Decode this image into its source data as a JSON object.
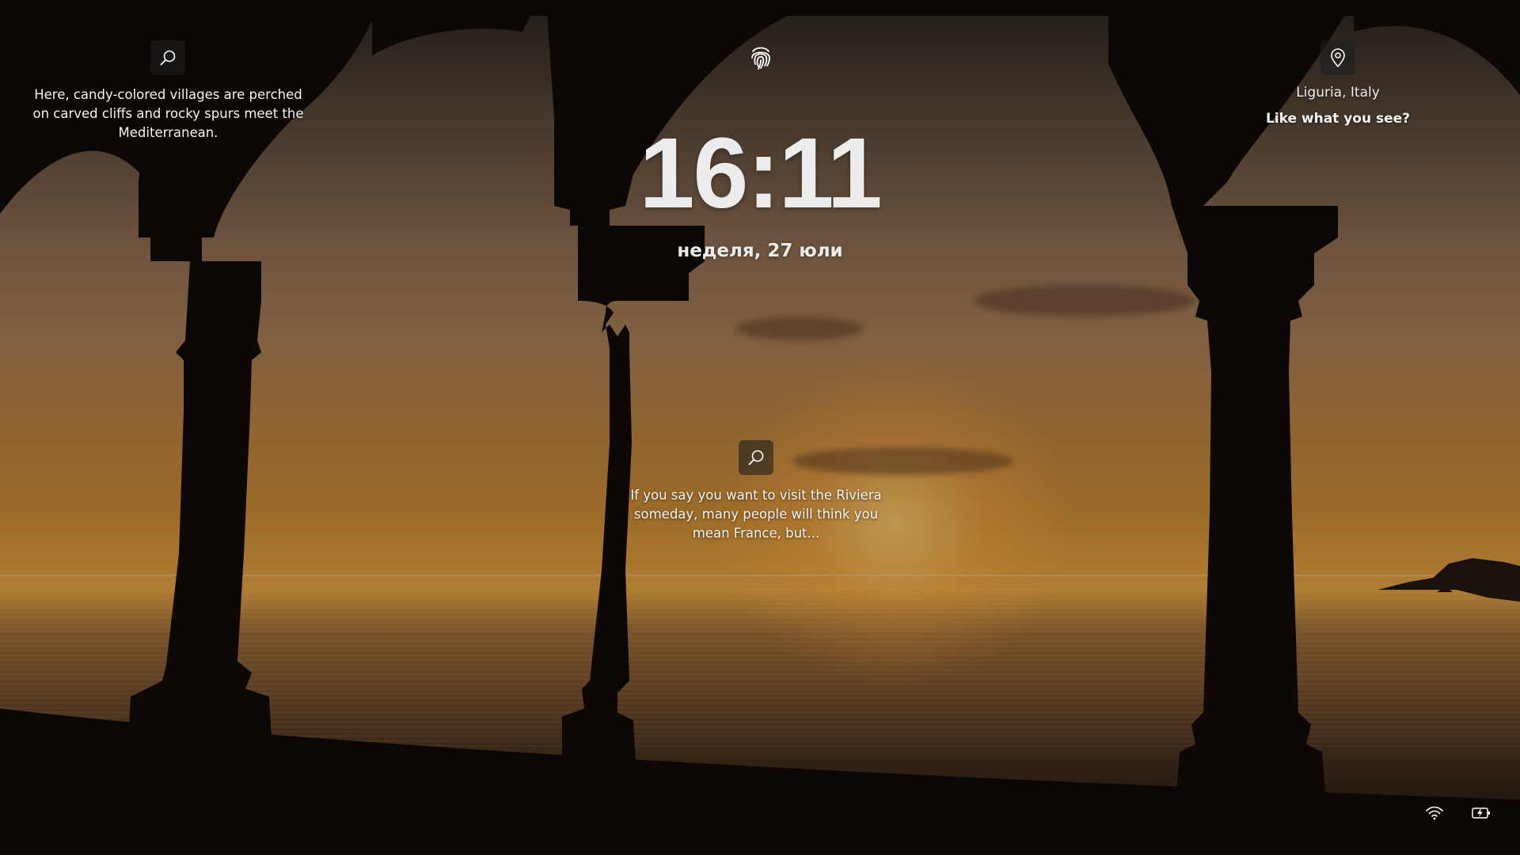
{
  "lockscreen": {
    "time": "16:11",
    "date": "неделя, 27 юли"
  },
  "spotlight": {
    "top_left_caption": "Here, candy-colored villages are perched\non carved cliffs and rocky spurs meet the\nMediterranean.",
    "center_caption": "If you say you want to visit the Riviera\nsomeday, many people will think you\nmean France, but...",
    "location": "Liguria, Italy",
    "like_prompt": "Like what you see?"
  },
  "icons": {
    "search": "search-icon",
    "fingerprint": "fingerprint-icon",
    "location": "location-pin-icon",
    "wifi": "wifi-icon",
    "battery": "battery-charging-icon"
  }
}
